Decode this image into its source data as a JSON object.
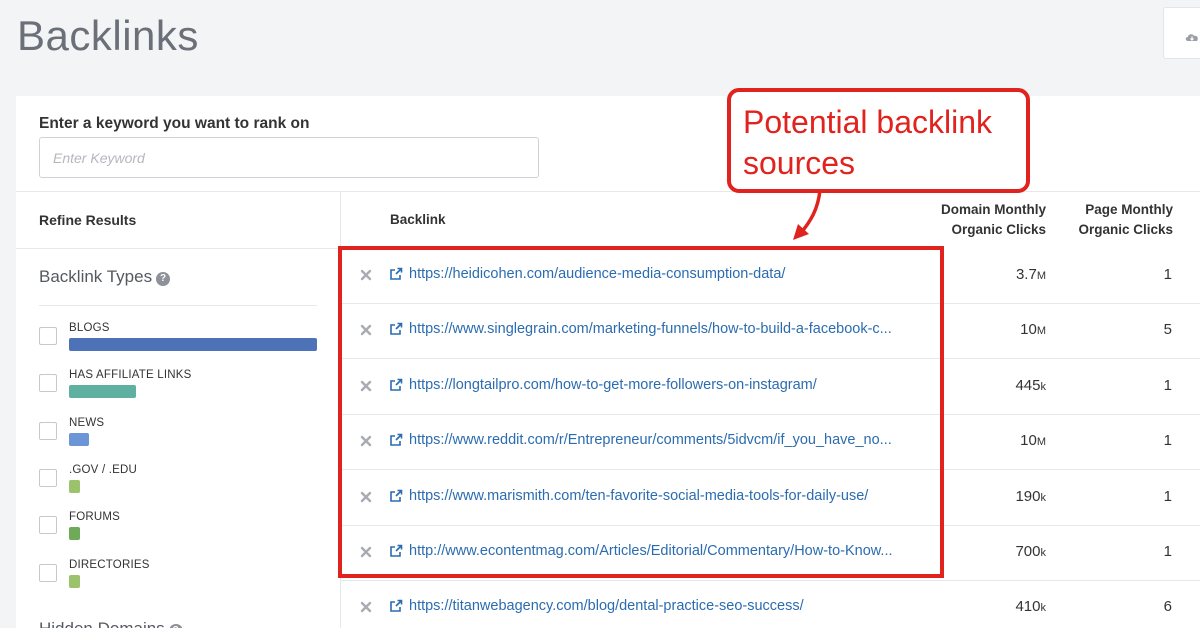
{
  "page": {
    "title": "Backlinks"
  },
  "keyword": {
    "label": "Enter a keyword you want to rank on",
    "placeholder": "Enter Keyword"
  },
  "sidebar": {
    "refine_title": "Refine Results",
    "types_title": "Backlink Types",
    "hidden_title": "Hidden Domains",
    "types": [
      {
        "label": "BLOGS",
        "color": "#4e72b8",
        "share": 1.0
      },
      {
        "label": "HAS AFFILIATE LINKS",
        "color": "#5fb0a0",
        "share": 0.27
      },
      {
        "label": "NEWS",
        "color": "#6b95d6",
        "share": 0.08
      },
      {
        "label": ".GOV / .EDU",
        "color": "#9cc26b",
        "share": 0.04
      },
      {
        "label": "FORUMS",
        "color": "#6faa58",
        "share": 0.04
      },
      {
        "label": "DIRECTORIES",
        "color": "#9cc26b",
        "share": 0.04
      }
    ]
  },
  "table": {
    "headers": {
      "backlink": "Backlink",
      "domain_1": "Domain Monthly",
      "domain_2": "Organic Clicks",
      "page_1": "Page Monthly",
      "page_2": "Organic Clicks"
    },
    "rows": [
      {
        "url": "https://heidicohen.com/audience-media-consumption-data/",
        "domain_num": "3.7",
        "domain_unit": "M",
        "page": "1"
      },
      {
        "url": "https://www.singlegrain.com/marketing-funnels/how-to-build-a-facebook-c...",
        "domain_num": "10",
        "domain_unit": "M",
        "page": "5"
      },
      {
        "url": "https://longtailpro.com/how-to-get-more-followers-on-instagram/",
        "domain_num": "445",
        "domain_unit": "k",
        "page": "1"
      },
      {
        "url": "https://www.reddit.com/r/Entrepreneur/comments/5idvcm/if_you_have_no...",
        "domain_num": "10",
        "domain_unit": "M",
        "page": "1"
      },
      {
        "url": "https://www.marismith.com/ten-favorite-social-media-tools-for-daily-use/",
        "domain_num": "190",
        "domain_unit": "k",
        "page": "1"
      },
      {
        "url": "http://www.econtentmag.com/Articles/Editorial/Commentary/How-to-Know...",
        "domain_num": "700",
        "domain_unit": "k",
        "page": "1"
      },
      {
        "url": "https://titanwebagency.com/blog/dental-practice-seo-success/",
        "domain_num": "410",
        "domain_unit": "k",
        "page": "6"
      }
    ]
  },
  "annotation": {
    "line1": "Potential backlink",
    "line2": "sources",
    "color": "#e0231e"
  }
}
